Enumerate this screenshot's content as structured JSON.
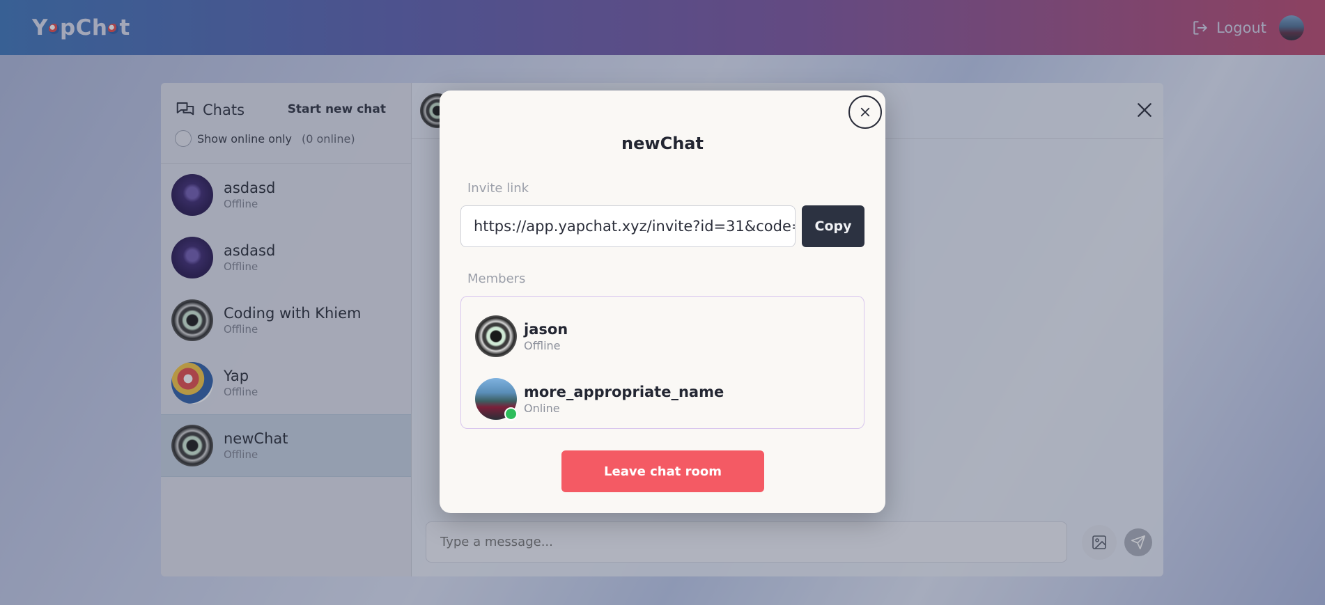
{
  "app": {
    "logo": "YapChat"
  },
  "header": {
    "logout_label": "Logout",
    "avatar_icon": "user-avatar"
  },
  "sidebar": {
    "title": "Chats",
    "title_icon": "chat-bubbles-icon",
    "new_chat_label": "Start new chat",
    "online_only_label": "Show online only",
    "online_count": "(0 online)",
    "items": [
      {
        "name": "asdasd",
        "status": "Offline"
      },
      {
        "name": "asdasd",
        "status": "Offline"
      },
      {
        "name": "Coding with Khiem",
        "status": "Offline"
      },
      {
        "name": "Yap",
        "status": "Offline"
      },
      {
        "name": "newChat",
        "status": "Offline",
        "active": true
      }
    ]
  },
  "composer": {
    "placeholder": "Type a message..."
  },
  "modal": {
    "title": "newChat",
    "invite_label": "Invite link",
    "invite_value": "https://app.yapchat.xyz/invite?id=31&code=",
    "copy_label": "Copy",
    "members_label": "Members",
    "members": [
      {
        "name": "jason",
        "status": "Offline"
      },
      {
        "name": "more_appropriate_name",
        "status": "Online"
      }
    ],
    "leave_label": "Leave chat room"
  },
  "colors": {
    "accent_danger": "#f45a64",
    "copy_button": "#2c3241",
    "online": "#2ebd5b"
  }
}
